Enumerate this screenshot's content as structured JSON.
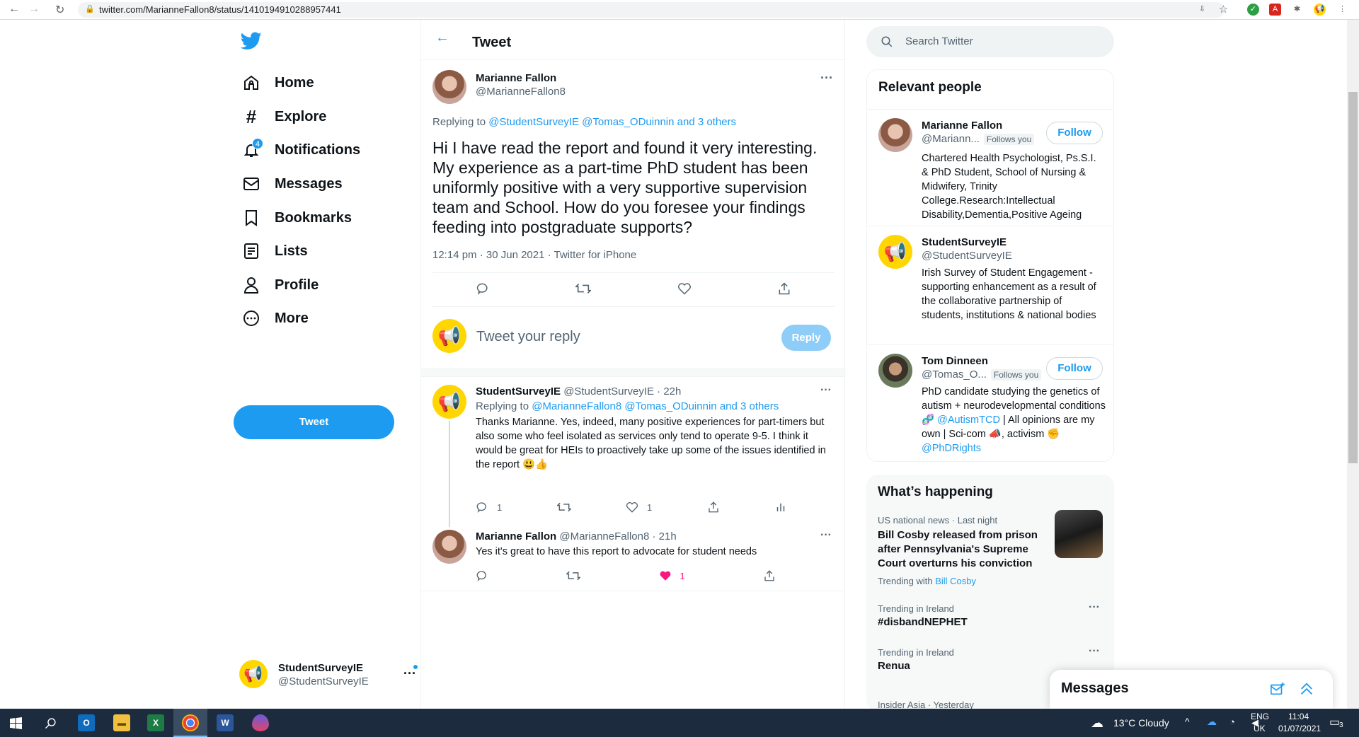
{
  "browser": {
    "url": "twitter.com/MarianneFallon8/status/1410194910288957441"
  },
  "sidebar": {
    "items": [
      {
        "label": "Home",
        "icon": "home-icon"
      },
      {
        "label": "Explore",
        "icon": "hashtag-icon"
      },
      {
        "label": "Notifications",
        "icon": "bell-icon",
        "badge": "4"
      },
      {
        "label": "Messages",
        "icon": "envelope-icon"
      },
      {
        "label": "Bookmarks",
        "icon": "bookmark-icon"
      },
      {
        "label": "Lists",
        "icon": "list-icon"
      },
      {
        "label": "Profile",
        "icon": "person-icon"
      },
      {
        "label": "More",
        "icon": "more-circle-icon"
      }
    ],
    "tweet_button": "Tweet",
    "account": {
      "name": "StudentSurveyIE",
      "handle": "@StudentSurveyIE"
    }
  },
  "main": {
    "header_title": "Tweet",
    "tweet": {
      "author": "Marianne Fallon",
      "handle": "@MarianneFallon8",
      "replying_prefix": "Replying to",
      "replying_to": "@StudentSurveyIE @Tomas_ODuinnin",
      "replying_others": "and 3 others",
      "text": "Hi I have read the report and found it very interesting. My experience as a part-time PhD student has been uniformly positive with a very supportive supervision team and School. How do you foresee your findings feeding into postgraduate supports?",
      "meta": "12:14 pm · 30 Jun 2021 · Twitter for iPhone"
    },
    "reply_box": {
      "placeholder": "Tweet your reply",
      "button": "Reply"
    },
    "replies": [
      {
        "name": "StudentSurveyIE",
        "handle_time": "@StudentSurveyIE · 22h",
        "replying_prefix": "Replying to",
        "replying_to": "@MarianneFallon8 @Tomas_ODuinnin",
        "replying_others": "and 3 others",
        "text": "Thanks Marianne. Yes, indeed, many positive experiences for part-timers but also some who feel isolated as services only tend to operate 9-5. I think it would be great for HEIs to proactively take up some of the issues identified in the report 😃👍",
        "reply_count": "1",
        "like_count": "1"
      },
      {
        "name": "Marianne Fallon",
        "handle_time": "@MarianneFallon8 · 21h",
        "text": "Yes it's great to have this report to advocate for student needs",
        "like_count": "1"
      }
    ]
  },
  "right": {
    "search_placeholder": "Search Twitter",
    "relevant_title": "Relevant people",
    "people": [
      {
        "name": "Marianne Fallon",
        "handle": "@Mariann...",
        "follows_you": "Follows you",
        "follow": "Follow",
        "bio": "Chartered Health Psychologist, Ps.S.I. & PhD Student, School of Nursing & Midwifery, Trinity College.Research:Intellectual Disability,Dementia,Positive Ageing"
      },
      {
        "name": "StudentSurveyIE",
        "handle": "@StudentSurveyIE",
        "bio": "Irish Survey of Student Engagement - supporting enhancement as a result of the collaborative partnership of students, institutions & national bodies"
      },
      {
        "name": "Tom Dinneen",
        "handle": "@Tomas_O...",
        "follows_you": "Follows you",
        "follow": "Follow",
        "bio_a": "PhD candidate studying the genetics of autism + neurodevelopmental conditions 🧬",
        "bio_link1": "@AutismTCD",
        "bio_b": " | All opinions are my own | Sci-com 📣, activism ✊",
        "bio_link2": "@PhDRights"
      }
    ],
    "happening_title": "What’s happening",
    "trends": [
      {
        "context": "US national news · Last night",
        "title": "Bill Cosby released from prison after Pennsylvania's Supreme Court overturns his conviction",
        "trending_with": "Trending with",
        "trending_link": "Bill Cosby"
      },
      {
        "context": "Trending in Ireland",
        "title": "#disbandNEPHET"
      },
      {
        "context": "Trending in Ireland",
        "title": "Renua"
      },
      {
        "context": "Insider Asia · Yesterday"
      }
    ],
    "messages_drawer": "Messages"
  },
  "taskbar": {
    "weather": "13°C  Cloudy",
    "lang_top": "ENG",
    "lang_bottom": "UK",
    "time": "11:04",
    "date": "01/07/2021",
    "notif_count": "3"
  }
}
